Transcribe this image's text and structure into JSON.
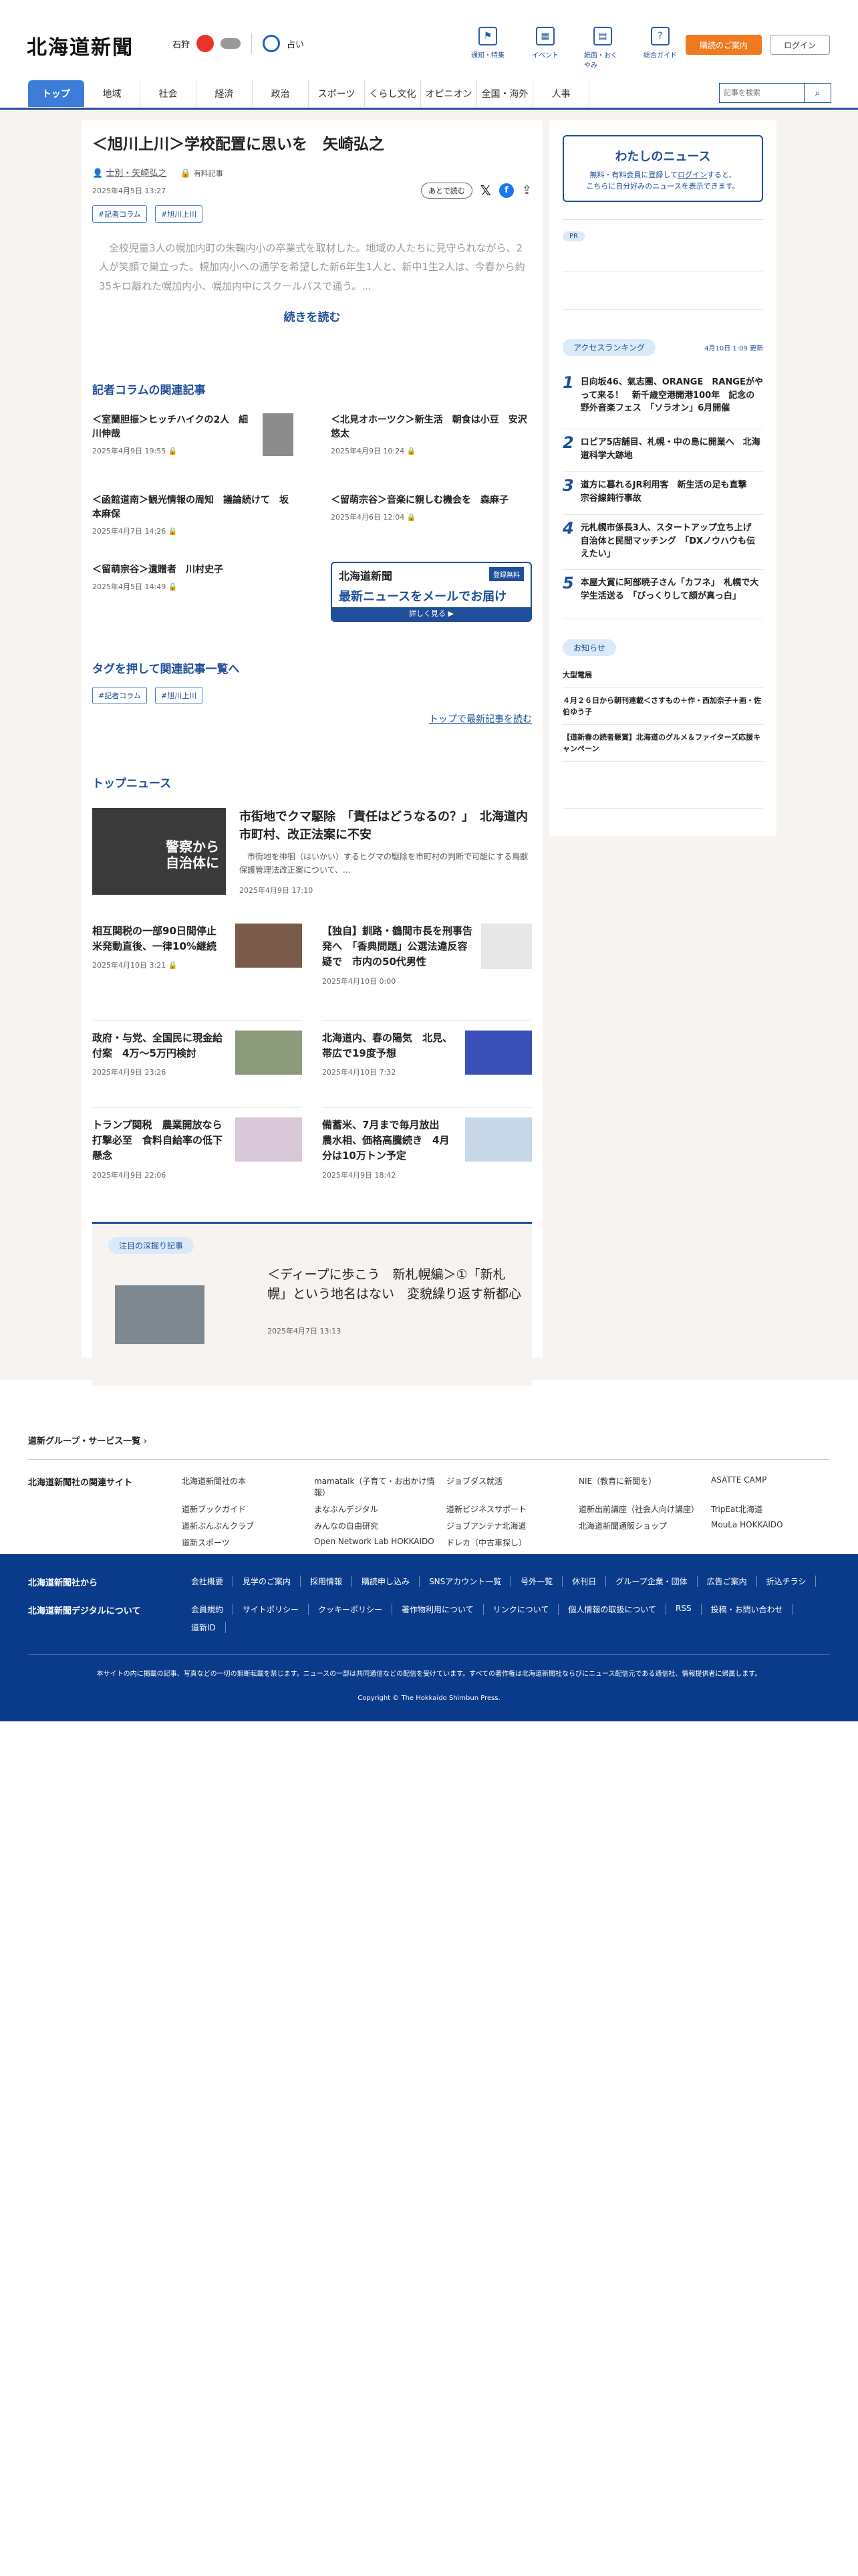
{
  "header": {
    "logo": "北海道新聞",
    "weather_area": "石狩",
    "fortune": "占い",
    "nav": [
      "通知・特集",
      "イベント",
      "紙面・おくやみ",
      "総合ガイド"
    ],
    "subscribe": "購読のご案内",
    "login": "ログイン"
  },
  "menu": {
    "items": [
      "トップ",
      "地域",
      "社会",
      "経済",
      "政治",
      "スポーツ",
      "くらし文化",
      "オピニオン",
      "全国・海外",
      "人事"
    ],
    "search_placeholder": "記事を検索"
  },
  "article": {
    "title": "＜旭川上川＞学校配置に思いを　矢崎弘之",
    "author": "士別・矢崎弘之",
    "author_badge": "有料記事",
    "date": "2025年4月5日 13:27",
    "read_later": "あとで読む",
    "tags": [
      "#記者コラム",
      "#旭川上川"
    ],
    "body": "　全校児童3人の幌加内町の朱鞠内小の卒業式を取材した。地域の人たちに見守られながら、2人が笑顔で巣立った。幌加内小への通学を希望した新6年生1人と、新中1生2人は、今春から約35キロ離れた幌加内小、幌加内中にスクールバスで通う。...",
    "read_more": "続きを読む"
  },
  "related": {
    "title": "記者コラムの関連記事",
    "items": [
      {
        "title": "＜室蘭胆振＞ヒッチハイクの2人　細川伸哉",
        "date": "2025年4月9日 19:55"
      },
      {
        "title": "＜北見オホーツク＞新生活　朝食は小豆　安沢悠太",
        "date": "2025年4月9日 10:24"
      },
      {
        "title": "＜函館道南＞観光情報の周知　議論続けて　坂本麻保",
        "date": "2025年4月7日 14:26"
      },
      {
        "title": "＜留萌宗谷＞音楽に親しむ機会を　森麻子",
        "date": "2025年4月6日 12:04"
      },
      {
        "title": "＜留萌宗谷＞遺贈者　川村史子",
        "date": "2025年4月5日 14:49"
      }
    ],
    "ad": {
      "logo": "北海道新聞",
      "badge": "登録無料",
      "headline": "最新ニュースをメールでお届け",
      "cta": "詳しく見る ▶"
    }
  },
  "tagsearch": {
    "title": "タグを押して関連記事一覧へ",
    "tags": [
      "#記者コラム",
      "#旭川上川"
    ],
    "latest": "トップで最新記事を読む"
  },
  "topnews": {
    "title": "トップニュース",
    "lead": {
      "img_text": "警察から自治体に",
      "title": "市街地でクマ駆除　「責任はどうなるの？」　北海道内市町村、改正法案に不安",
      "summary": "　市街地を徘徊（はいかい）するヒグマの駆除を市町村の判断で可能にする鳥獣保護管理法改正案について、...",
      "date": "2025年4月9日 17:10"
    },
    "items": [
      {
        "title": "相互関税の一部90日間停止　米発動直後、一律10%継続",
        "date": "2025年4月10日 3:21"
      },
      {
        "title": "【独自】釧路・鶴間市長を刑事告発へ　「香典問題」公選法違反容疑で　市内の50代男性",
        "date": "2025年4月10日 0:00"
      },
      {
        "title": "政府・与党、全国民に現金給付案　4万～5万円検討",
        "date": "2025年4月9日 23:26"
      },
      {
        "title": "北海道内、春の陽気　北見、帯広で19度予想",
        "date": "2025年4月10日 7:32"
      },
      {
        "title": "トランプ関税　農業開放なら打撃必至　食料自給率の低下懸念",
        "date": "2025年4月9日 22:06"
      },
      {
        "title": "備蓄米、7月まで毎月放出　農水相、価格高騰続き　4月分は10万トン予定",
        "date": "2025年4月9日 18:42"
      }
    ]
  },
  "feature": {
    "label": "注目の深掘り記事",
    "title": "＜ディープに歩こう　新札幌編＞①「新札幌」という地名はない　変貌繰り返す新都心",
    "date": "2025年4月7日 13:13"
  },
  "sidebar": {
    "mynews_title": "わたしのニュース",
    "mynews_text1": "無料・有料会員に登録して",
    "mynews_link": "ログイン",
    "mynews_text2": "すると、",
    "mynews_text3": "こちらに自分好みのニュースを表示できます。",
    "pr": "PR",
    "ranking_title": "アクセスランキング",
    "ranking_updated": "4月10日 1:09 更新",
    "ranking": [
      "日向坂46、氣志團、ORANGE　RANGEがやって来る！　新千歳空港開港100年　記念の野外音楽フェス　「ソラオン」6月開催",
      "ロピア5店舗目、札幌・中の島に開業へ　北海道科学大跡地",
      "道方に暮れるJR利用客　新生活の足も直撃　宗谷線鈍行事故",
      "元札幌市係長3人、スタートアップ立ち上げ 自治体と民間マッチング　「DXノウハウも伝えたい」",
      "本屋大賞に阿部暁子さん「カフネ」　札幌で大学生活送る　「びっくりして顔が真っ白」"
    ],
    "notice_title": "お知らせ",
    "notices": [
      "大型電展",
      "４月２６日から朝刊連載＜さすもの＋作・西加奈子＋画・佐伯ゆう子",
      "【道新春の読者懸賞】北海道のグルメ＆ファイターズ応援キャンペーン"
    ]
  },
  "group": {
    "services": "道新グループ・サービス一覧",
    "related_sites": "北海道新聞社の関連サイト",
    "sites": [
      "北海道新聞社の本",
      "mamatalk（子育て・お出かけ情報）",
      "ジョブダス就活",
      "NIE（教育に新聞を）",
      "ASATTE CAMP",
      "道新ブックガイド",
      "まなぶんデジタル",
      "道新ビジネスサポート",
      "道新出前講座（社会人向け講座）",
      "TripEat北海道",
      "道新ぶんぶんクラブ",
      "みんなの自由研究",
      "ジョブアンテナ北海道",
      "北海道新聞通販ショップ",
      "MouLa HOKKAIDO",
      "道新スポーツ",
      "Open Network Lab HOKKAIDO",
      "ドレカ（中古車探し）",
      "",
      ""
    ]
  },
  "footer": {
    "label1": "北海道新聞社から",
    "label2": "北海道新聞デジタルについて",
    "links1": [
      "会社概要",
      "見学のご案内",
      "採用情報",
      "購読申し込み",
      "SNSアカウント一覧",
      "号外一覧",
      "休刊日",
      "グループ企業・団体",
      "広告ご案内",
      "折込チラシ"
    ],
    "links2": [
      "会員規約",
      "サイトポリシー",
      "クッキーポリシー",
      "著作物利用について",
      "リンクについて",
      "個人情報の取扱について",
      "RSS",
      "投稿・お問い合わせ",
      "道新ID"
    ],
    "notice": "本サイトの内に掲載の記事、写真などの一切の無断転載を禁じます。ニュースの一部は共同通信などの配信を受けています。すべての著作権は北海道新聞社ならびにニュース配信元である通信社、情報提供者に帰属します。",
    "copyright": "Copyright © The Hokkaido Shimbun Press."
  }
}
